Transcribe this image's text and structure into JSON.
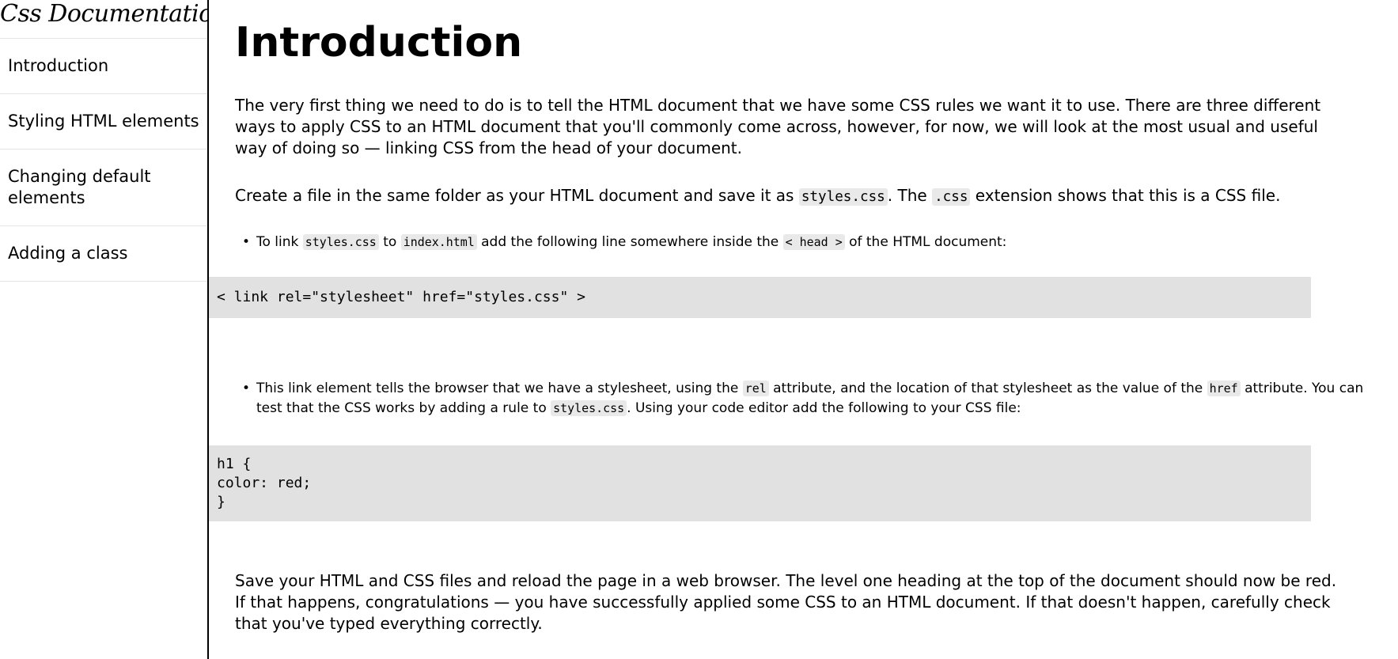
{
  "nav": {
    "header": "Css Documentation",
    "items": [
      {
        "label": "Introduction"
      },
      {
        "label": "Styling HTML elements"
      },
      {
        "label": "Changing default elements"
      },
      {
        "label": "Adding a class"
      }
    ]
  },
  "main": {
    "title": "Introduction",
    "intro": "The very first thing we need to do is to tell the HTML document that we have some CSS rules we want it to use. There are three different ways to apply CSS to an HTML document that you'll commonly come across, however, for now, we will look at the most usual and useful way of doing so — linking CSS from the head of your document.",
    "create_file": {
      "before": "Create a file in the same folder as your HTML document and save it as ",
      "code1": "styles.css",
      "middle": ". The ",
      "code2": ".css",
      "after": " extension shows that this is a CSS file."
    },
    "bullet1": {
      "part1": "To link ",
      "code1": "styles.css",
      "part2": " to ",
      "code2": "index.html",
      "part3": " add the following line somewhere inside the ",
      "code3": "< head >",
      "part4": " of the HTML document:"
    },
    "code_block_1": "< link rel=\"stylesheet\" href=\"styles.css\" >",
    "bullet2": {
      "part1": "This link element tells the browser that we have a stylesheet, using the ",
      "code1": "rel",
      "part2": " attribute, and the location of that stylesheet as the value of the ",
      "code2": "href",
      "part3": " attribute. You can test that the CSS works by adding a rule to ",
      "code3": "styles.css",
      "part4": ". Using your code editor add the following to your CSS file:"
    },
    "code_block_2": {
      "line1": "h1 {",
      "line2": "color: red;",
      "line3": "}"
    },
    "outro": "Save your HTML and CSS files and reload the page in a web browser. The level one heading at the top of the document should now be red. If that happens, congratulations — you have successfully applied some CSS to an HTML document. If that doesn't happen, carefully check that you've typed everything correctly."
  }
}
